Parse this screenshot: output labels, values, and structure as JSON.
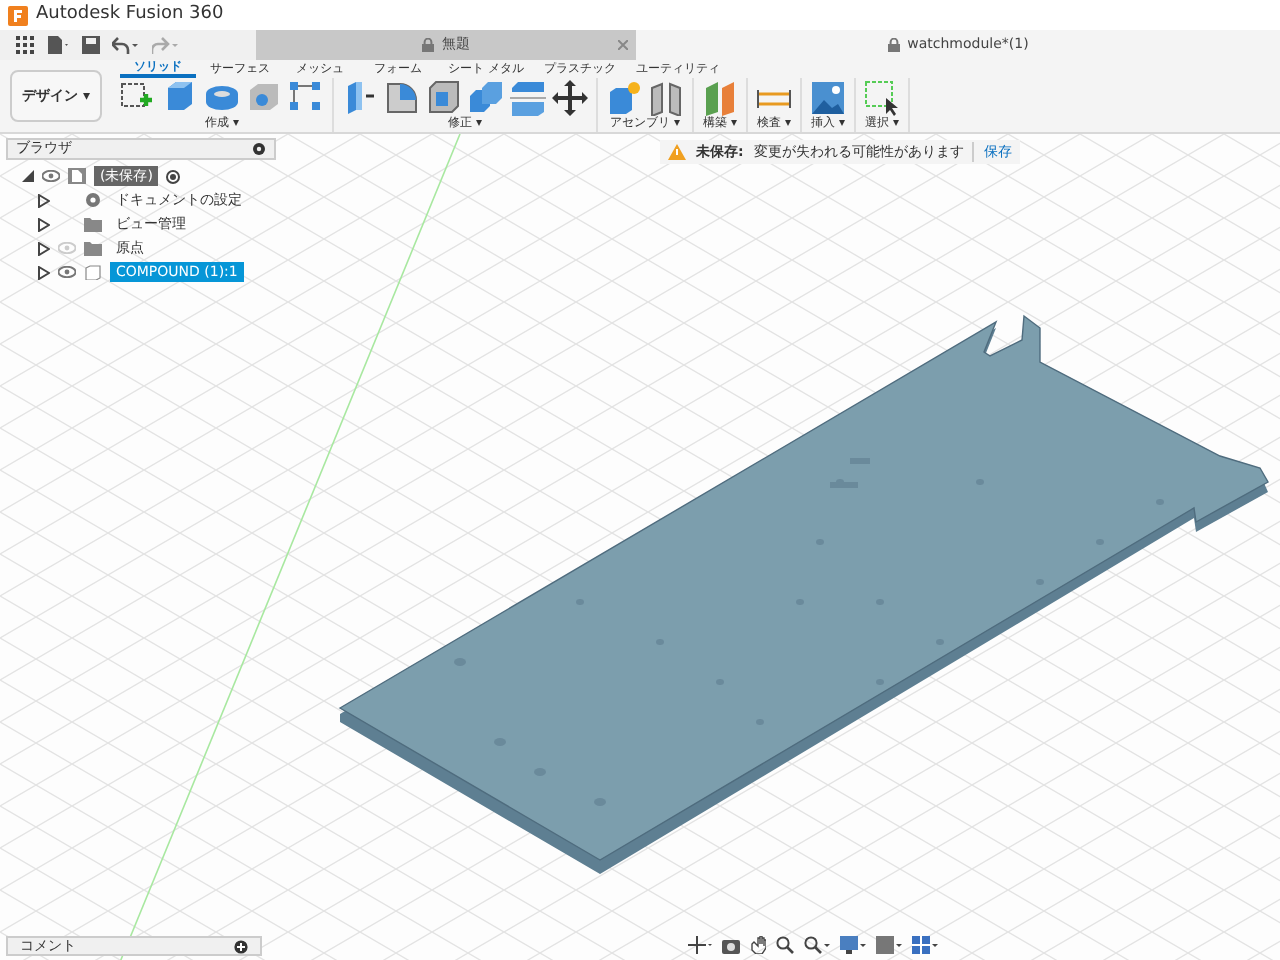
{
  "window": {
    "title": "Autodesk Fusion 360"
  },
  "doc_tabs": [
    {
      "label": "無題",
      "selected": false,
      "closable": true
    },
    {
      "label": "watchmodule*(1)",
      "selected": true,
      "closable": false
    }
  ],
  "workspace": {
    "label": "デザイン",
    "caret": "▾"
  },
  "toolbar_tabs": [
    {
      "label": "ソリッド",
      "selected": true
    },
    {
      "label": "サーフェス",
      "selected": false
    },
    {
      "label": "メッシュ",
      "selected": false
    },
    {
      "label": "フォーム",
      "selected": false
    },
    {
      "label": "シート メタル",
      "selected": false
    },
    {
      "label": "プラスチック",
      "selected": false
    },
    {
      "label": "ユーティリティ",
      "selected": false
    }
  ],
  "tool_groups": [
    {
      "label": "作成 ▾",
      "tools": [
        {
          "kind": "sketch"
        },
        {
          "kind": "extrude"
        },
        {
          "kind": "revolve"
        },
        {
          "kind": "hole"
        },
        {
          "kind": "pattern"
        }
      ]
    },
    {
      "label": "修正 ▾",
      "tools": [
        {
          "kind": "presspull"
        },
        {
          "kind": "fillet"
        },
        {
          "kind": "shell"
        },
        {
          "kind": "combine"
        },
        {
          "kind": "split"
        },
        {
          "kind": "move"
        }
      ]
    },
    {
      "label": "アセンブリ ▾",
      "tools": [
        {
          "kind": "component"
        },
        {
          "kind": "joint"
        }
      ]
    },
    {
      "label": "構築 ▾",
      "tools": [
        {
          "kind": "plane"
        }
      ]
    },
    {
      "label": "検査 ▾",
      "tools": [
        {
          "kind": "measure"
        }
      ]
    },
    {
      "label": "挿入 ▾",
      "tools": [
        {
          "kind": "image"
        }
      ]
    },
    {
      "label": "選択 ▾",
      "tools": [
        {
          "kind": "select"
        }
      ]
    }
  ],
  "browser": {
    "title": "ブラウザ",
    "items": [
      {
        "label": "(未保存)",
        "kind": "root",
        "expanded": true,
        "visible": true,
        "selected": false,
        "children": [
          {
            "label": "ドキュメントの設定",
            "kind": "settings",
            "expanded": false,
            "selected": false
          },
          {
            "label": "ビュー管理",
            "kind": "folder",
            "expanded": false,
            "selected": false
          },
          {
            "label": "原点",
            "kind": "folder",
            "expanded": false,
            "visible": false,
            "selected": false
          },
          {
            "label": "COMPOUND (1):1",
            "kind": "component",
            "expanded": false,
            "visible": true,
            "selected": true
          }
        ]
      }
    ]
  },
  "notice": {
    "label": "未保存:",
    "message": "変更が失われる可能性があります",
    "action": "保存"
  },
  "comments": {
    "title": "コメント"
  }
}
